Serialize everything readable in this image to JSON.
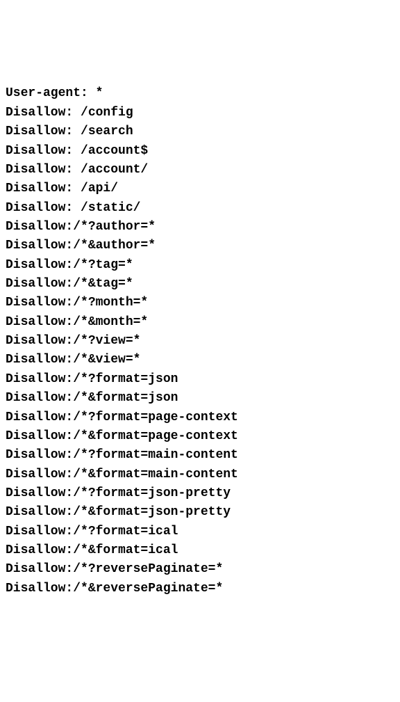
{
  "lines": [
    "User-agent: *",
    "Disallow: /config",
    "Disallow: /search",
    "Disallow: /account$",
    "Disallow: /account/",
    "Disallow: /api/",
    "Disallow: /static/",
    "Disallow:/*?author=*",
    "Disallow:/*&author=*",
    "Disallow:/*?tag=*",
    "Disallow:/*&tag=*",
    "Disallow:/*?month=*",
    "Disallow:/*&month=*",
    "Disallow:/*?view=*",
    "Disallow:/*&view=*",
    "Disallow:/*?format=json",
    "Disallow:/*&format=json",
    "Disallow:/*?format=page-context",
    "Disallow:/*&format=page-context",
    "Disallow:/*?format=main-content",
    "Disallow:/*&format=main-content",
    "Disallow:/*?format=json-pretty",
    "Disallow:/*&format=json-pretty",
    "Disallow:/*?format=ical",
    "Disallow:/*&format=ical",
    "Disallow:/*?reversePaginate=*",
    "Disallow:/*&reversePaginate=*"
  ]
}
